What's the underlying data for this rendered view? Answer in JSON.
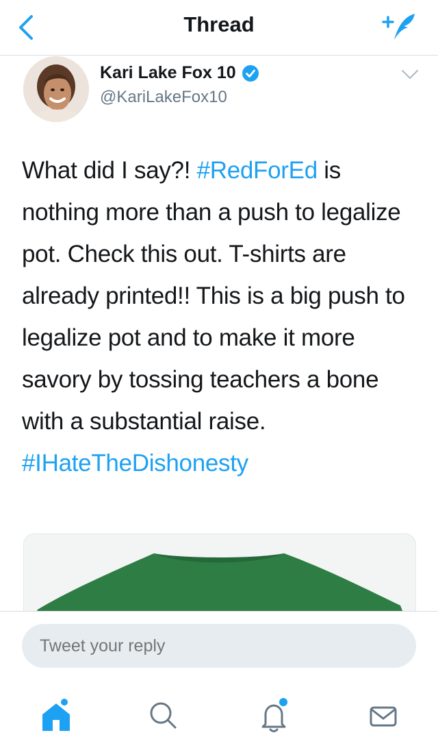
{
  "header": {
    "title": "Thread"
  },
  "author": {
    "name": "Kari Lake Fox 10",
    "handle": "@KariLakeFox10"
  },
  "tweet": {
    "line1_pre": "What did I say?! ",
    "hashtag1": "#RedForEd",
    "line1_post": " is",
    "body": "nothing more than a push to legalize pot. Check this out. T-shirts are already printed!! This is a big push to legalize pot and to make it more savory by tossing teachers a bone with a substantial raise.",
    "hashtag2": "#IHateTheDishonesty"
  },
  "reply": {
    "placeholder": "Tweet your reply"
  },
  "colors": {
    "accent": "#1da1f2",
    "shirt": "#2e7d44"
  },
  "tabs": [
    {
      "icon": "home-icon",
      "badge": true
    },
    {
      "icon": "search-icon",
      "badge": false
    },
    {
      "icon": "notifications-icon",
      "badge": true
    },
    {
      "icon": "messages-icon",
      "badge": false
    }
  ]
}
